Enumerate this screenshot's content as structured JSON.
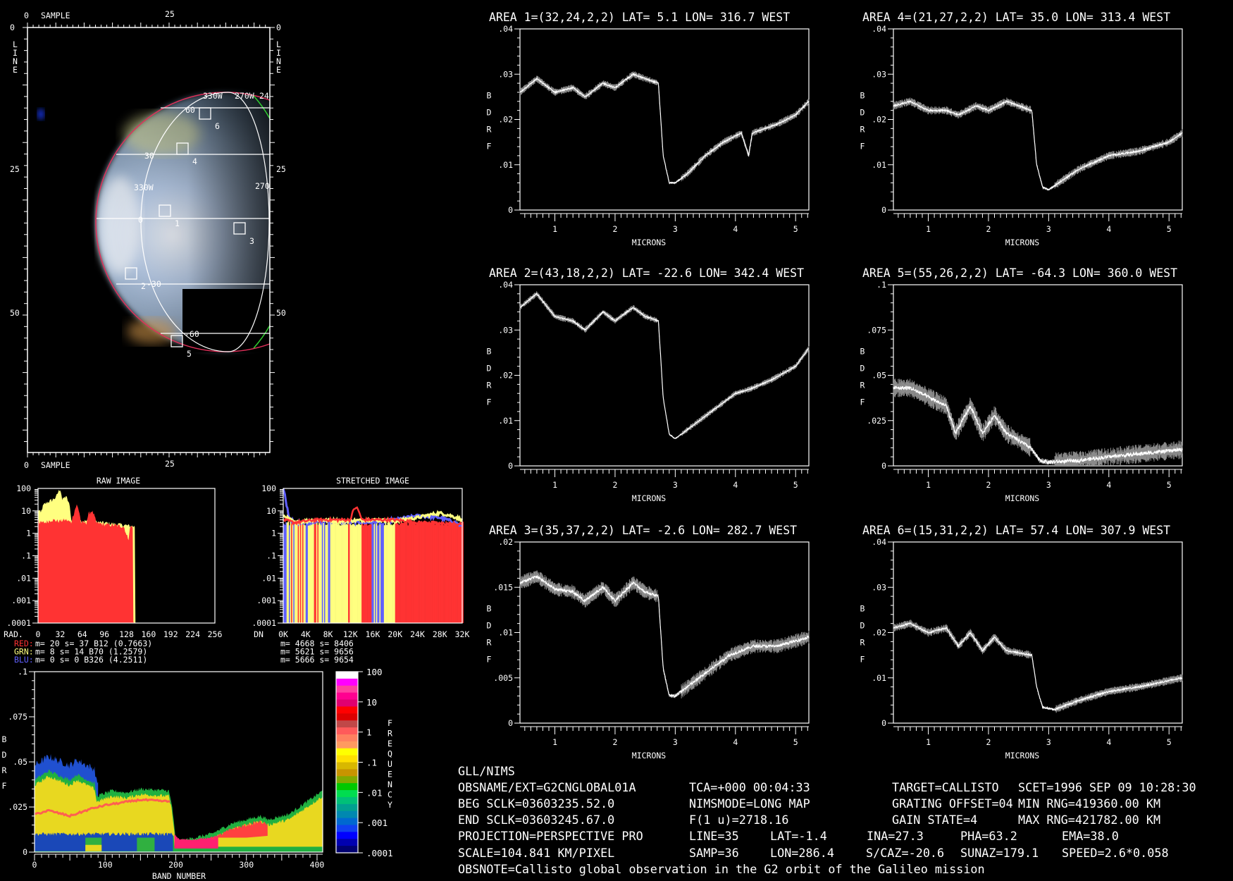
{
  "colors": {
    "background": "#000000",
    "foreground": "#ffffff",
    "red": "#ff3333",
    "green": "#ffff80",
    "blue": "#6060ff",
    "limb": "#e0305a"
  },
  "map": {
    "sample_label": "SAMPLE",
    "line_label": "LINE",
    "sample_ticks": [
      "0",
      "25"
    ],
    "line_ticks": [
      "0",
      "25",
      "50"
    ],
    "lat_labels": [
      "60",
      "30",
      "0",
      "-30",
      "-60"
    ],
    "lon_labels": [
      "330W",
      "270W",
      "24",
      "330W",
      "270"
    ],
    "area_labels": [
      "1",
      "2",
      "3",
      "4",
      "5",
      "6"
    ]
  },
  "raw_hist": {
    "title": "RAW IMAGE",
    "axis_name": "RAD.",
    "x_ticks": [
      "0",
      "32",
      "64",
      "96",
      "128",
      "160",
      "192",
      "224",
      "256"
    ],
    "y_ticks": [
      "100",
      "10",
      "1",
      ".1",
      ".01",
      ".001",
      ".0001"
    ],
    "legend": [
      {
        "name": "RED:",
        "text": "m=   20 s=   37 B12  (0.7663)"
      },
      {
        "name": "GRN:",
        "text": "m=    8 s=   14 B70  (1.2579)"
      },
      {
        "name": "BLU:",
        "text": "m=    0 s=    0 B326 (4.2511)"
      }
    ]
  },
  "stretched_hist": {
    "title": "STRETCHED IMAGE",
    "axis_name": "DN",
    "x_ticks": [
      "0K",
      "4K",
      "8K",
      "12K",
      "16K",
      "20K",
      "24K",
      "28K",
      "32K"
    ],
    "y_ticks": [
      "100",
      "10",
      "1",
      ".1",
      ".01",
      ".001",
      ".0001"
    ],
    "legend": [
      "m= 4668 s= 8406",
      "m= 5621 s= 9656",
      "m= 5666 s= 9654"
    ]
  },
  "density": {
    "ylabel": "BDRF",
    "xlabel": "BAND NUMBER",
    "y_ticks": [
      ".1",
      ".075",
      ".05",
      ".025",
      "0"
    ],
    "x_ticks": [
      "0",
      "100",
      "200",
      "300",
      "400"
    ],
    "colorbar_label": "FREQUENCY",
    "colorbar_ticks": [
      "100",
      "10",
      "1",
      ".1",
      ".01",
      ".001",
      ".0001"
    ]
  },
  "chart_data": [
    {
      "type": "line",
      "title": "AREA 1=(32,24,2,2) LAT=   5.1 LON= 316.7 WEST",
      "xlabel": "MICRONS",
      "ylabel": "BDRF",
      "xlim": [
        0.42,
        5.22
      ],
      "ylim": [
        0,
        0.04
      ],
      "y_ticks": [
        ".04",
        ".03",
        ".02",
        ".01",
        "0"
      ],
      "x_ticks": [
        "1",
        "2",
        "3",
        "4",
        "5"
      ],
      "noise": 0.0006,
      "x": [
        0.42,
        0.7,
        1.0,
        1.3,
        1.5,
        1.8,
        2.0,
        2.3,
        2.5,
        2.72,
        2.8,
        2.9,
        3.0,
        3.2,
        3.5,
        3.8,
        4.1,
        4.22,
        4.28,
        4.7,
        5.0,
        5.22
      ],
      "y": [
        0.026,
        0.029,
        0.026,
        0.027,
        0.025,
        0.028,
        0.027,
        0.03,
        0.029,
        0.028,
        0.012,
        0.006,
        0.006,
        0.008,
        0.012,
        0.015,
        0.017,
        0.012,
        0.017,
        0.019,
        0.021,
        0.024
      ]
    },
    {
      "type": "line",
      "title": "AREA 4=(21,27,2,2) LAT=  35.0 LON= 313.4 WEST",
      "xlabel": "MICRONS",
      "ylabel": "BDRF",
      "xlim": [
        0.42,
        5.22
      ],
      "ylim": [
        0,
        0.04
      ],
      "y_ticks": [
        ".04",
        ".03",
        ".02",
        ".01",
        "0"
      ],
      "x_ticks": [
        "1",
        "2",
        "3",
        "4",
        "5"
      ],
      "noise": 0.0007,
      "x": [
        0.42,
        0.7,
        1.0,
        1.3,
        1.5,
        1.8,
        2.0,
        2.3,
        2.5,
        2.72,
        2.8,
        2.9,
        3.0,
        3.5,
        4.0,
        4.5,
        5.0,
        5.22
      ],
      "y": [
        0.023,
        0.024,
        0.022,
        0.022,
        0.021,
        0.023,
        0.022,
        0.024,
        0.023,
        0.022,
        0.01,
        0.005,
        0.0045,
        0.009,
        0.012,
        0.013,
        0.015,
        0.017
      ]
    },
    {
      "type": "line",
      "title": "AREA 2=(43,18,2,2) LAT= -22.6 LON= 342.4 WEST",
      "xlabel": "MICRONS",
      "ylabel": "BDRF",
      "xlim": [
        0.42,
        5.22
      ],
      "ylim": [
        0,
        0.04
      ],
      "y_ticks": [
        ".04",
        ".03",
        ".02",
        ".01",
        "0"
      ],
      "x_ticks": [
        "1",
        "2",
        "3",
        "4",
        "5"
      ],
      "noise": 0.0005,
      "x": [
        0.42,
        0.7,
        1.0,
        1.3,
        1.5,
        1.8,
        2.0,
        2.3,
        2.5,
        2.72,
        2.8,
        2.9,
        3.0,
        3.3,
        3.6,
        4.0,
        4.25,
        4.6,
        5.0,
        5.22
      ],
      "y": [
        0.035,
        0.038,
        0.033,
        0.032,
        0.03,
        0.034,
        0.032,
        0.035,
        0.033,
        0.032,
        0.015,
        0.007,
        0.006,
        0.009,
        0.012,
        0.016,
        0.017,
        0.019,
        0.022,
        0.026
      ]
    },
    {
      "type": "line",
      "title": "AREA 5=(55,26,2,2) LAT= -64.3 LON= 360.0 WEST",
      "xlabel": "MICRONS",
      "ylabel": "BDRF",
      "xlim": [
        0.42,
        5.22
      ],
      "ylim": [
        0,
        0.1
      ],
      "y_ticks": [
        ".1",
        ".075",
        ".05",
        ".025",
        "0"
      ],
      "x_ticks": [
        "1",
        "2",
        "3",
        "4",
        "5"
      ],
      "noise": 0.004,
      "x": [
        0.42,
        0.7,
        1.0,
        1.3,
        1.45,
        1.7,
        1.9,
        2.1,
        2.3,
        2.7,
        2.85,
        3.0,
        3.5,
        4.0,
        5.22
      ],
      "y": [
        0.043,
        0.043,
        0.038,
        0.033,
        0.018,
        0.033,
        0.018,
        0.028,
        0.018,
        0.01,
        0.003,
        0.002,
        0.003,
        0.005,
        0.009
      ]
    },
    {
      "type": "line",
      "title": "AREA 3=(35,37,2,2) LAT=  -2.6 LON= 282.7 WEST",
      "xlabel": "MICRONS",
      "ylabel": "BDRF",
      "xlim": [
        0.42,
        5.22
      ],
      "ylim": [
        0,
        0.02
      ],
      "y_ticks": [
        ".02",
        ".015",
        ".01",
        ".005",
        "0"
      ],
      "x_ticks": [
        "1",
        "2",
        "3",
        "4",
        "5"
      ],
      "noise": 0.0006,
      "x": [
        0.42,
        0.7,
        1.0,
        1.3,
        1.5,
        1.8,
        2.0,
        2.3,
        2.5,
        2.72,
        2.8,
        2.9,
        3.0,
        3.5,
        3.9,
        4.3,
        4.7,
        5.22
      ],
      "y": [
        0.0155,
        0.0162,
        0.0148,
        0.0145,
        0.0135,
        0.015,
        0.0135,
        0.0155,
        0.0145,
        0.014,
        0.006,
        0.003,
        0.003,
        0.0055,
        0.0075,
        0.0085,
        0.0085,
        0.0095
      ]
    },
    {
      "type": "line",
      "title": "AREA 6=(15,31,2,2) LAT=  57.4 LON= 307.9 WEST",
      "xlabel": "MICRONS",
      "ylabel": "BDRF",
      "xlim": [
        0.42,
        5.22
      ],
      "ylim": [
        0,
        0.04
      ],
      "y_ticks": [
        ".04",
        ".03",
        ".02",
        ".01",
        "0"
      ],
      "x_ticks": [
        "1",
        "2",
        "3",
        "4",
        "5"
      ],
      "noise": 0.0007,
      "x": [
        0.42,
        0.7,
        1.0,
        1.3,
        1.5,
        1.7,
        1.9,
        2.1,
        2.3,
        2.72,
        2.8,
        2.9,
        3.1,
        3.5,
        4.0,
        4.5,
        5.22
      ],
      "y": [
        0.021,
        0.022,
        0.02,
        0.021,
        0.017,
        0.02,
        0.016,
        0.019,
        0.016,
        0.015,
        0.008,
        0.0035,
        0.003,
        0.005,
        0.007,
        0.008,
        0.01
      ]
    }
  ],
  "info": {
    "instrument": "GLL/NIMS",
    "obsname": "OBSNAME/EXT=G2CNGLOBAL01A",
    "beg_sclk": "BEG SCLK=03603235.52.0",
    "end_sclk": "END SCLK=03603245.67.0",
    "projection": "PROJECTION=PERSPECTIVE PRO",
    "scale": "SCALE=104.841 KM/PIXEL",
    "obsnote": "OBSNOTE=Callisto global observation in the G2 orbit of the Galileo mission",
    "tca": "TCA=+000 00:04:33",
    "nimsmode": "NIMSMODE=LONG MAP",
    "f1u": "F(1 u)=2718.16",
    "line": "LINE=35",
    "samp": "SAMP=36",
    "lat": "LAT=-1.4",
    "lon": "LON=286.4",
    "target": "TARGET=CALLISTO",
    "grating": "GRATING OFFSET=04",
    "gain": "GAIN STATE=4",
    "scet": "SCET=1996 SEP 09 10:28:30",
    "min_rng": "MIN RNG=419360.00 KM",
    "max_rng": "MAX RNG=421782.00 KM",
    "ina": "INA=27.3",
    "pha": "PHA=63.2",
    "ema": "EMA=38.0",
    "scaz": "S/CAZ=-20.6",
    "sunaz": "SUNAZ=179.1",
    "speed": "SPEED=2.6*0.058"
  }
}
